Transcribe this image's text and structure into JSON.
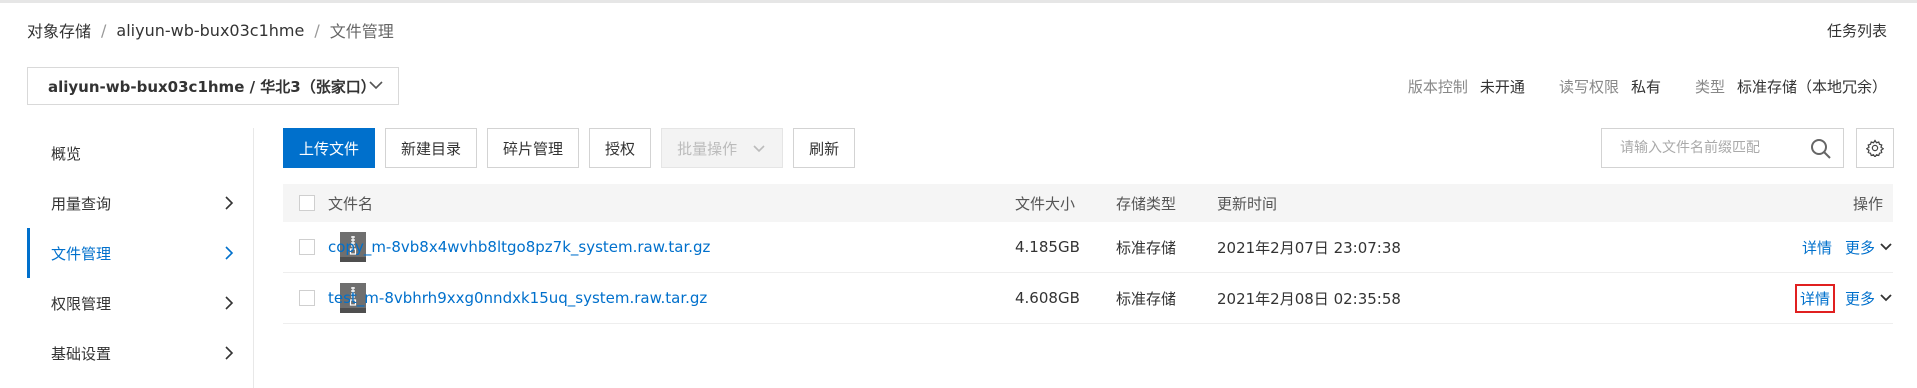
{
  "breadcrumb": {
    "root": "对象存储",
    "sep": "/",
    "bucket": "aliyun-wb-bux03c1hme",
    "current": "文件管理"
  },
  "task_list": "任务列表",
  "bucket_selector": {
    "value": "aliyun-wb-bux03c1hme / 华北3（张家口）"
  },
  "properties": [
    {
      "label": "版本控制",
      "value": "未开通"
    },
    {
      "label": "读写权限",
      "value": "私有"
    },
    {
      "label": "类型",
      "value": "标准存储（本地冗余）"
    }
  ],
  "sidebar": {
    "items": [
      {
        "label": "概览",
        "has_arrow": false
      },
      {
        "label": "用量查询",
        "has_arrow": true
      },
      {
        "label": "文件管理",
        "has_arrow": true,
        "active": true
      },
      {
        "label": "权限管理",
        "has_arrow": true
      },
      {
        "label": "基础设置",
        "has_arrow": true
      }
    ]
  },
  "toolbar": {
    "upload": "上传文件",
    "new_dir": "新建目录",
    "fragments": "碎片管理",
    "authorize": "授权",
    "batch": "批量操作",
    "refresh": "刷新"
  },
  "search": {
    "placeholder": "请输入文件名前缀匹配"
  },
  "table": {
    "columns": {
      "name": "文件名",
      "size": "文件大小",
      "storage": "存储类型",
      "updated": "更新时间",
      "action": "操作"
    },
    "rows": [
      {
        "name": "copy_m-8vb8x4wvhb8ltgo8pz7k_system.raw.tar.gz",
        "size": "4.185GB",
        "storage": "标准存储",
        "updated": "2021年2月07日 23:07:38",
        "detail": "详情",
        "more": "更多",
        "highlighted": false
      },
      {
        "name": "test_m-8vbhrh9xxg0nndxk15uq_system.raw.tar.gz",
        "size": "4.608GB",
        "storage": "标准存储",
        "updated": "2021年2月08日 02:35:58",
        "detail": "详情",
        "more": "更多",
        "highlighted": true
      }
    ]
  },
  "colors": {
    "primary": "#0070cc",
    "highlight_box": "#e02020"
  },
  "icons": {
    "bucket_dropdown": "chevron-down-icon",
    "sidebar_arrow": "chevron-right-icon",
    "search": "search-icon",
    "settings": "gear-icon",
    "file": "archive-file-icon"
  }
}
